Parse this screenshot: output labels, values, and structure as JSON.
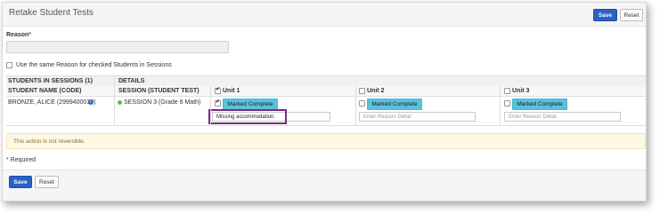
{
  "header": {
    "title": "Retake Student Tests",
    "save_label": "Save",
    "reset_label": "Reset"
  },
  "reason": {
    "label": "Reason",
    "required_mark": "*",
    "value": "",
    "same_reason_label": "Use the same Reason for checked Students in Sessions",
    "same_reason_checked": false
  },
  "table": {
    "group_headers": [
      "STUDENTS IN SESSIONS (1)",
      "DETAILS"
    ],
    "col_student": "STUDENT NAME (CODE)",
    "col_session": "SESSION (STUDENT TEST)",
    "units": [
      {
        "label": "Unit 1",
        "checked": true
      },
      {
        "label": "Unit 2",
        "checked": false
      },
      {
        "label": "Unit 3",
        "checked": false
      }
    ],
    "row": {
      "student": "BRONZE, ALICE (2999400039)",
      "info_icon": "info-icon",
      "session": "SESSION 3 (Grade 6 Math)",
      "session_status_color": "#5cb85c",
      "units": [
        {
          "checked": true,
          "status": "Marked Complete",
          "detail_value": "Missing accommodation.",
          "detail_placeholder": "Enter Reason Detail"
        },
        {
          "checked": false,
          "status": "Marked Complete",
          "detail_value": "",
          "detail_placeholder": "Enter Reason Detail"
        },
        {
          "checked": false,
          "status": "Marked Complete",
          "detail_value": "",
          "detail_placeholder": "Enter Reason Detail"
        }
      ]
    }
  },
  "warning": "This action is not reversible.",
  "required_note": "* Required",
  "footer": {
    "save_label": "Save",
    "reset_label": "Reset"
  },
  "colors": {
    "primary": "#2a61c4",
    "status_tag": "#5bc0de",
    "highlight": "#7b2a7d",
    "warning_bg": "#fcf8e3"
  }
}
